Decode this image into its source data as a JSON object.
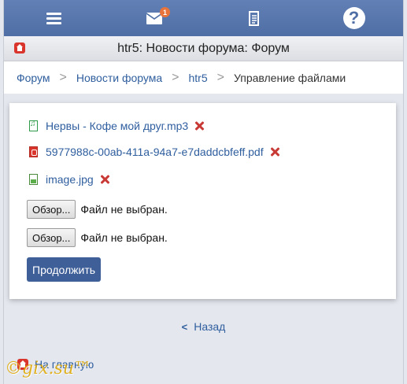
{
  "topbar": {
    "menu_icon": "hamburger-menu-icon",
    "mail_icon": "envelope-icon",
    "mail_badge": "1",
    "doc_icon": "document-icon",
    "help_icon": "question-mark-icon",
    "help_glyph": "?"
  },
  "titlebar": {
    "title": "htr5: Новости форума: Форум"
  },
  "breadcrumb": {
    "items": [
      {
        "label": "Форум"
      },
      {
        "label": "Новости форума"
      },
      {
        "label": "htr5"
      }
    ],
    "current": "Управление файлами",
    "separator": ">"
  },
  "files": [
    {
      "name": "Нервы - Кофе мой друг.mp3",
      "icon": "audio-file-icon"
    },
    {
      "name": "5977988c-00ab-411a-94a7-e7daddcbfeff.pdf",
      "icon": "pdf-file-icon"
    },
    {
      "name": "image.jpg",
      "icon": "image-file-icon"
    }
  ],
  "uploads": [
    {
      "button": "Обзор...",
      "status": "Файл не выбран."
    },
    {
      "button": "Обзор...",
      "status": "Файл не выбран."
    }
  ],
  "submit_label": "Продолжить",
  "back": {
    "chevron": "<",
    "label": "Назад"
  },
  "home_link": "На главную",
  "watermark": "©gix.su™",
  "colors": {
    "topbar": "#5575ab",
    "link": "#2f5e9e",
    "button": "#3f5f99",
    "delete": "#c83a36",
    "badge": "#e8743b"
  }
}
